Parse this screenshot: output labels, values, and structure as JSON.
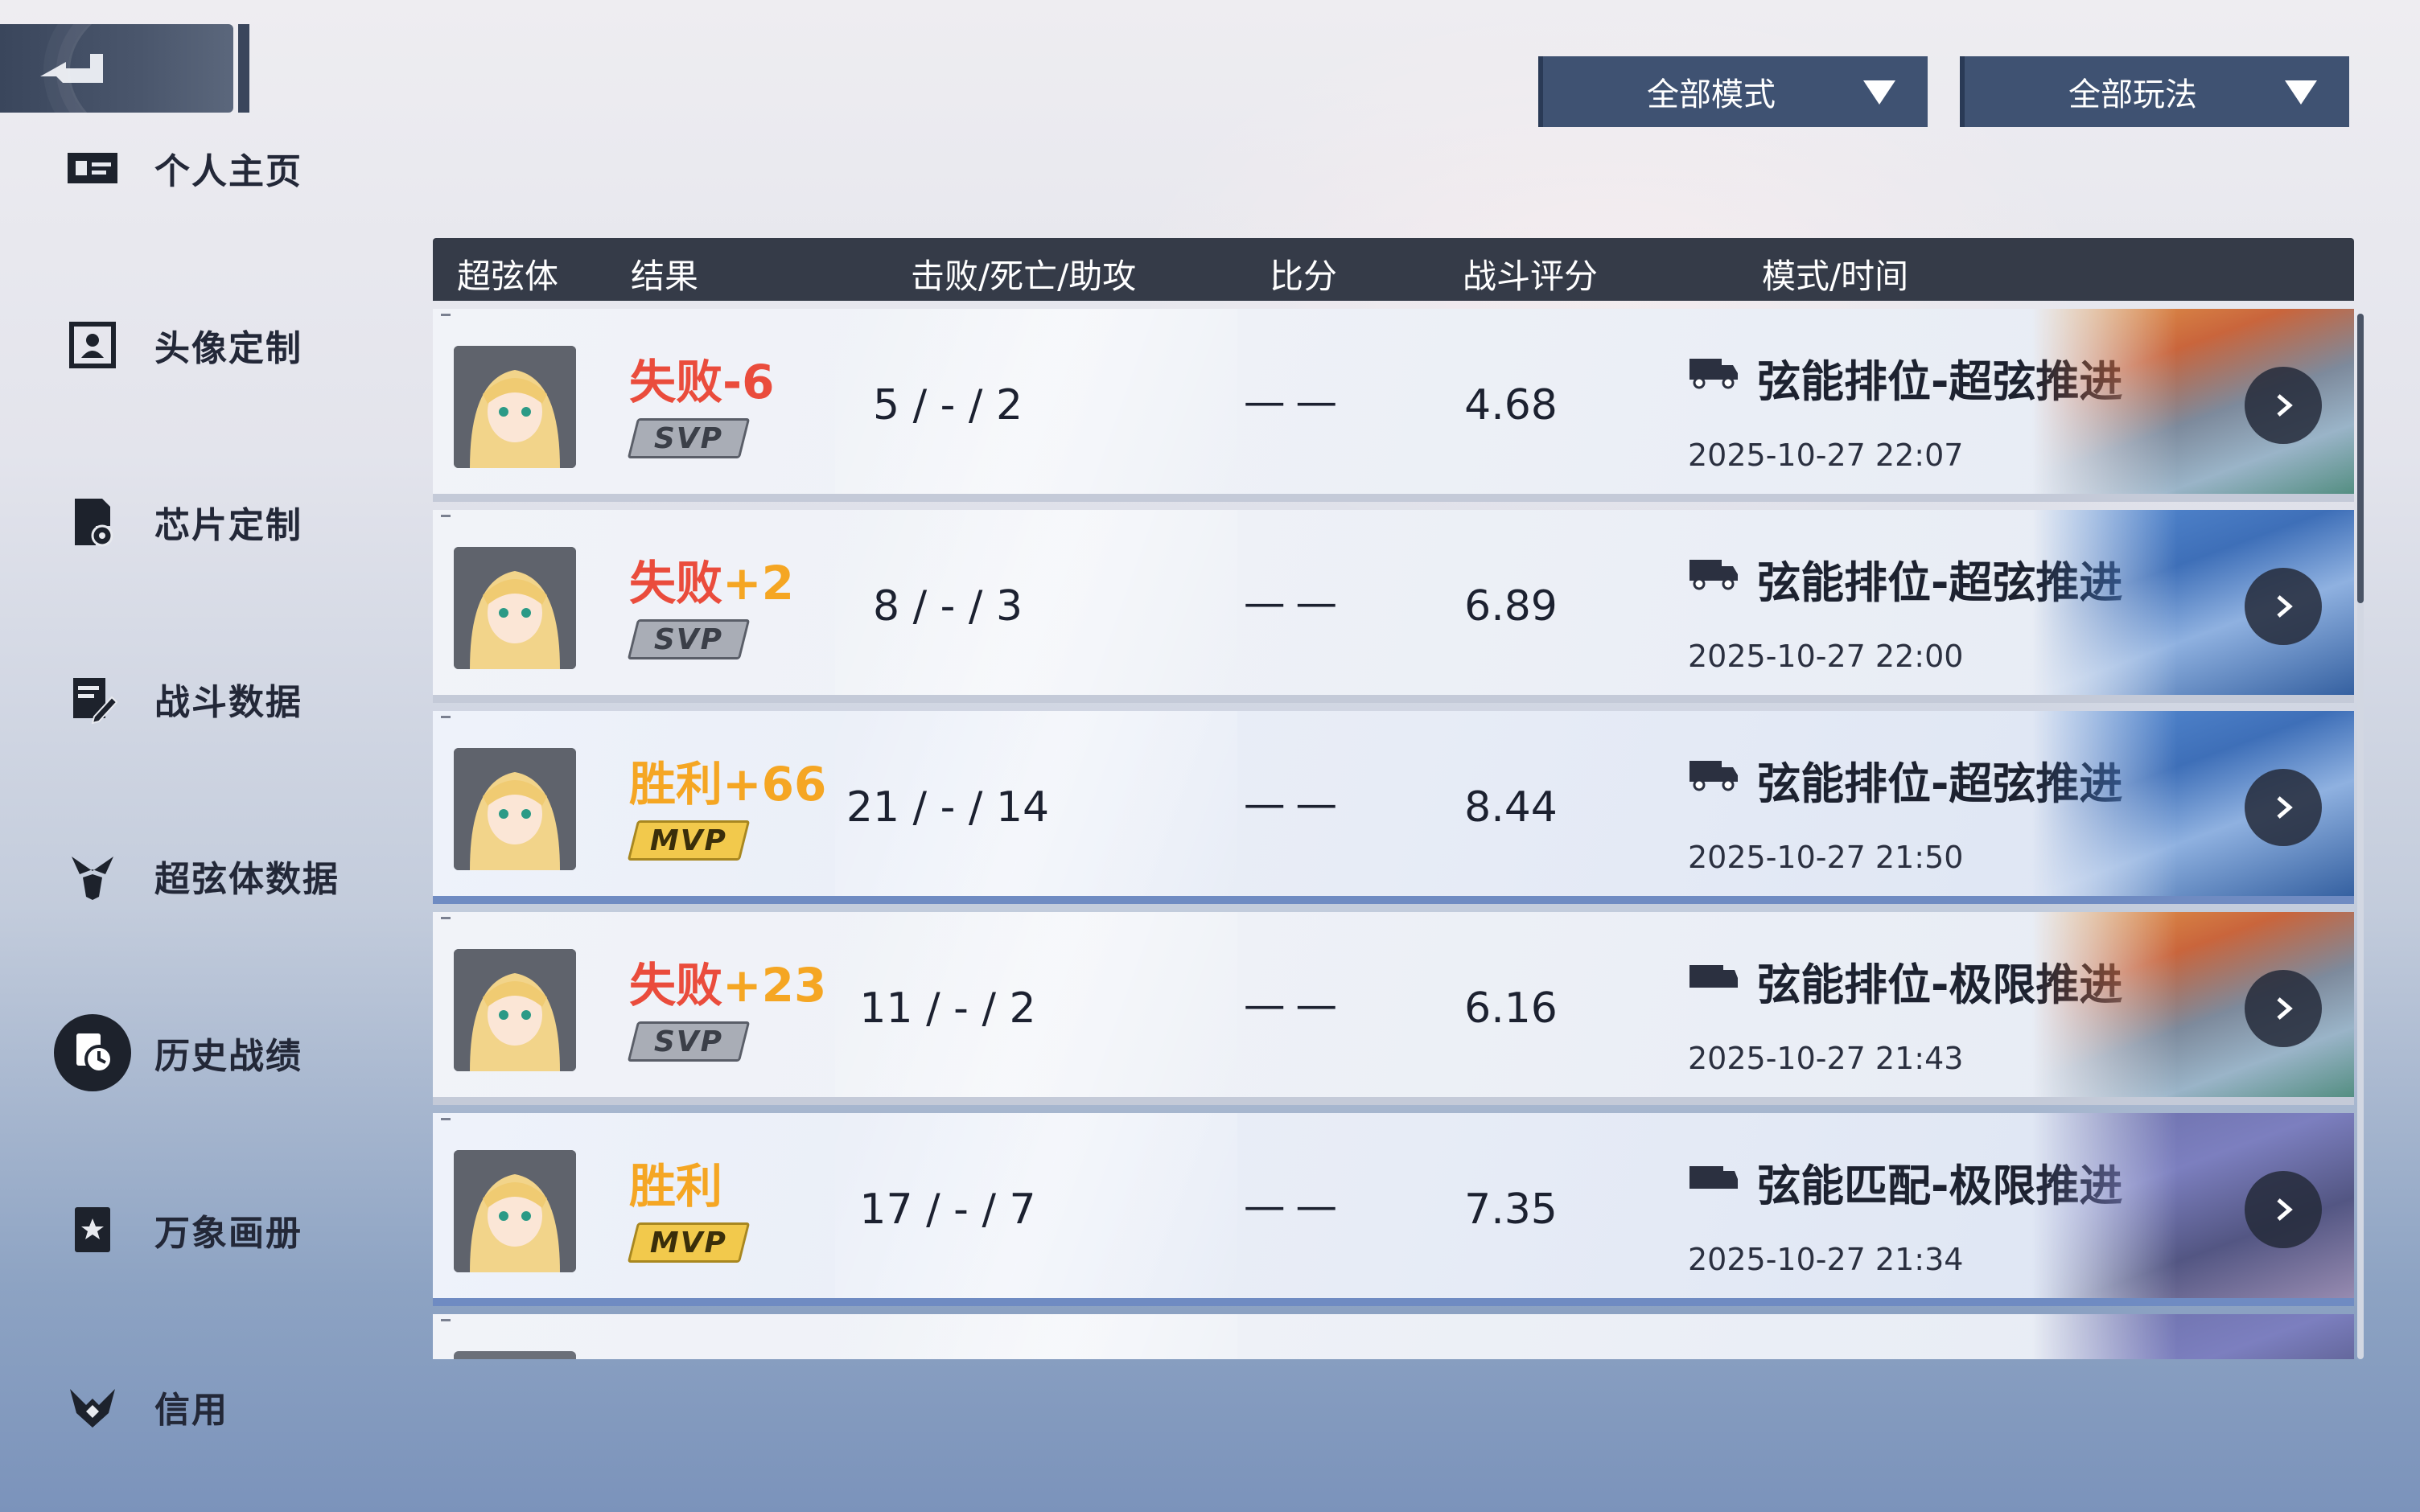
{
  "sidebar": {
    "items": [
      {
        "label": "个人主页",
        "icon": "profile-card-icon"
      },
      {
        "label": "头像定制",
        "icon": "avatar-frame-icon"
      },
      {
        "label": "芯片定制",
        "icon": "chip-gear-icon"
      },
      {
        "label": "战斗数据",
        "icon": "battle-data-icon"
      },
      {
        "label": "超弦体数据",
        "icon": "character-data-icon"
      },
      {
        "label": "历史战绩",
        "icon": "history-clock-icon",
        "active": true
      },
      {
        "label": "万象画册",
        "icon": "album-star-icon"
      },
      {
        "label": "信用",
        "icon": "credit-wings-icon"
      }
    ]
  },
  "filters": {
    "mode": "全部模式",
    "play": "全部玩法"
  },
  "table": {
    "headers": {
      "character": "超弦体",
      "result": "结果",
      "kda": "击败/死亡/助攻",
      "score": "比分",
      "rating": "战斗评分",
      "mode_time": "模式/时间"
    },
    "rows": [
      {
        "result": "失败",
        "delta": "-6",
        "badge": "SVP",
        "kda": "5 / - / 2",
        "score": "— —",
        "rating": "4.68",
        "mode": "弦能排位-超弦推进",
        "time": "2025-10-27 22:07"
      },
      {
        "result": "失败",
        "delta": "+2",
        "badge": "SVP",
        "kda": "8 / - / 3",
        "score": "— —",
        "rating": "6.89",
        "mode": "弦能排位-超弦推进",
        "time": "2025-10-27 22:00"
      },
      {
        "result": "胜利",
        "delta": "+66",
        "badge": "MVP",
        "kda": "21 / - / 14",
        "score": "— —",
        "rating": "8.44",
        "mode": "弦能排位-超弦推进",
        "time": "2025-10-27 21:50"
      },
      {
        "result": "失败",
        "delta": "+23",
        "badge": "SVP",
        "kda": "11 / - / 2",
        "score": "— —",
        "rating": "6.16",
        "mode": "弦能排位-极限推进",
        "time": "2025-10-27 21:43"
      },
      {
        "result": "胜利",
        "delta": "",
        "badge": "MVP",
        "kda": "17 / - / 7",
        "score": "— —",
        "rating": "7.35",
        "mode": "弦能匹配-极限推进",
        "time": "2025-10-27 21:34"
      }
    ]
  }
}
